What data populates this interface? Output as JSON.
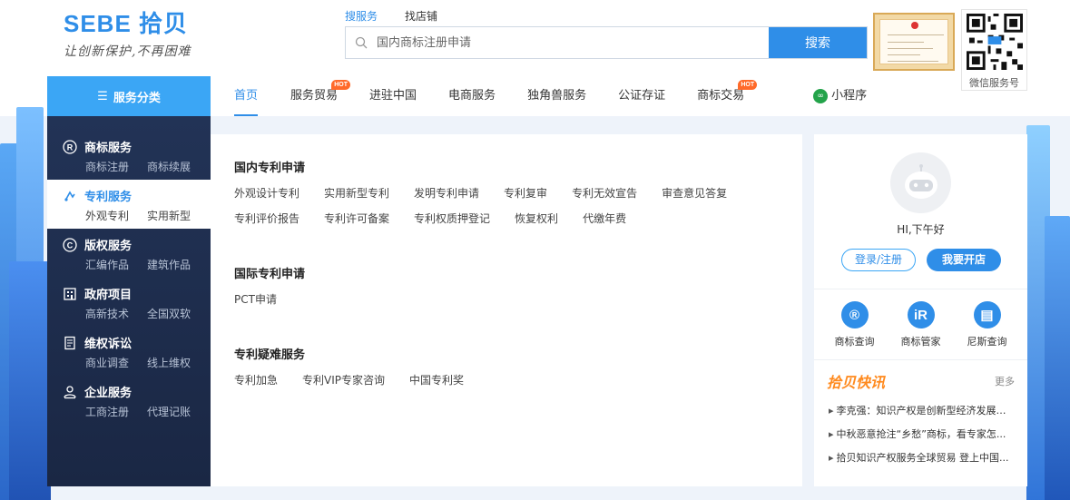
{
  "logo": {
    "name": "SEBE 拾贝",
    "slogan": "让创新保护,不再困难"
  },
  "search": {
    "tabs": [
      "搜服务",
      "找店铺"
    ],
    "active_tab": 0,
    "placeholder": "国内商标注册申请",
    "button_label": "搜索"
  },
  "qr": {
    "caption": "微信服务号"
  },
  "sidebar": {
    "header": "服务分类",
    "categories": [
      {
        "title": "商标服务",
        "icon": "registered-icon",
        "subs": [
          "商标注册",
          "商标续展"
        ]
      },
      {
        "title": "专利服务",
        "icon": "patent-icon",
        "subs": [
          "外观专利",
          "实用新型"
        ],
        "active": true
      },
      {
        "title": "版权服务",
        "icon": "copyright-icon",
        "subs": [
          "汇编作品",
          "建筑作品"
        ]
      },
      {
        "title": "政府项目",
        "icon": "building-icon",
        "subs": [
          "高新技术",
          "全国双软"
        ]
      },
      {
        "title": "维权诉讼",
        "icon": "document-icon",
        "subs": [
          "商业调查",
          "线上维权"
        ]
      },
      {
        "title": "企业服务",
        "icon": "user-icon",
        "subs": [
          "工商注册",
          "代理记账"
        ]
      }
    ]
  },
  "nav": {
    "items": [
      {
        "label": "首页",
        "active": true
      },
      {
        "label": "服务贸易",
        "hot": true
      },
      {
        "label": "进驻中国"
      },
      {
        "label": "电商服务"
      },
      {
        "label": "独角兽服务"
      },
      {
        "label": "公证存证"
      },
      {
        "label": "商标交易",
        "hot": true
      }
    ],
    "hot_label": "HOT",
    "mini_program": "小程序"
  },
  "panel": {
    "sections": [
      {
        "title": "国内专利申请",
        "links": [
          "外观设计专利",
          "实用新型专利",
          "发明专利申请",
          "专利复审",
          "专利无效宣告",
          "审查意见答复",
          "专利评价报告",
          "专利许可备案",
          "专利权质押登记",
          "恢复权利",
          "代缴年费"
        ]
      },
      {
        "title": "国际专利申请",
        "links": [
          "PCT申请"
        ]
      },
      {
        "title": "专利疑难服务",
        "links": [
          "专利加急",
          "专利VIP专家咨询",
          "中国专利奖"
        ]
      }
    ]
  },
  "user": {
    "greeting": "HI,下午好",
    "login_label": "登录/注册",
    "open_label": "我要开店",
    "tools": [
      {
        "label": "商标查询",
        "glyph": "®"
      },
      {
        "label": "商标管家",
        "glyph": "iR"
      },
      {
        "label": "尼斯查询",
        "glyph": "▤"
      }
    ]
  },
  "news": {
    "title": "拾贝快讯",
    "more": "更多",
    "items": [
      "李克强：知识产权是创新型经济发展的...",
      "中秋恶意抢注“乡愁”商标，看专家怎...",
      "拾贝知识产权服务全球贸易 登上中国..."
    ]
  },
  "colors": {
    "brand": "#2f8ee8",
    "sidebar": "#1f2e4f",
    "hot": "#ff6a2a",
    "news_title": "#ff8a1e"
  }
}
